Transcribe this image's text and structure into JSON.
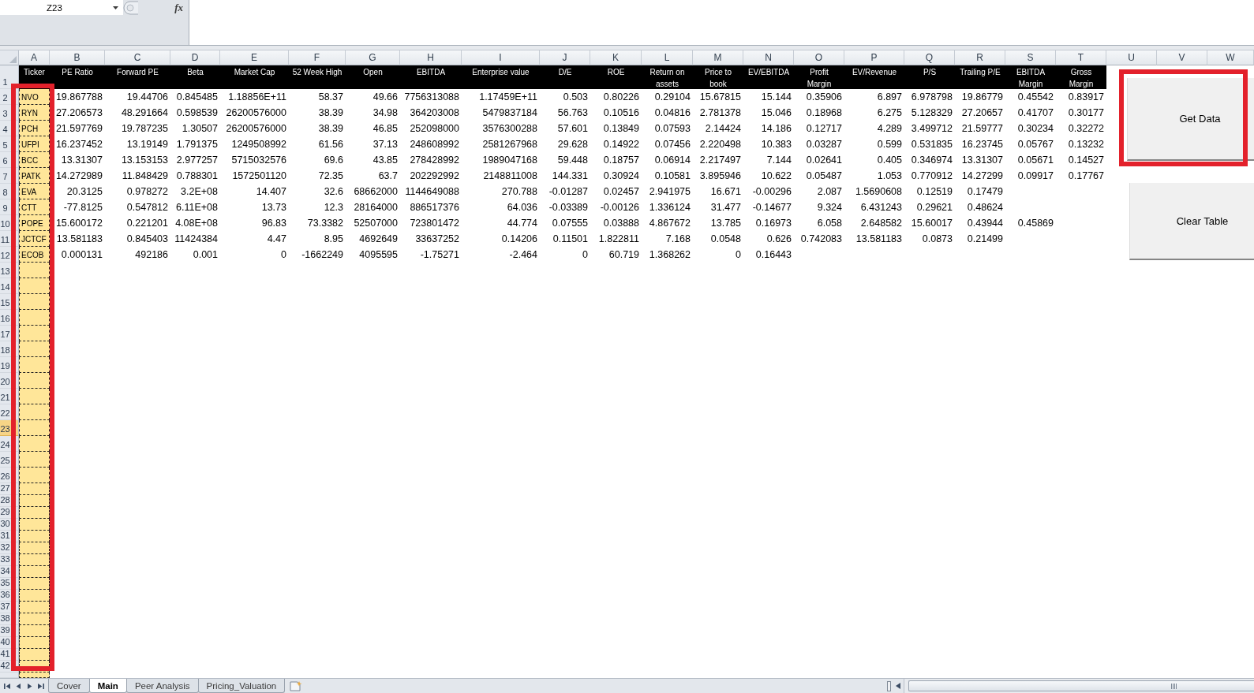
{
  "formula_bar": {
    "name_box": "Z23",
    "function_button": "fx"
  },
  "sheet": {
    "columns": [
      {
        "letter": "A",
        "highlighted": true
      },
      {
        "letter": "B",
        "highlighted": false
      },
      {
        "letter": "C",
        "highlighted": false
      },
      {
        "letter": "D",
        "highlighted": false
      },
      {
        "letter": "E",
        "highlighted": false
      },
      {
        "letter": "F",
        "highlighted": false
      },
      {
        "letter": "G",
        "highlighted": false
      },
      {
        "letter": "H",
        "highlighted": false
      },
      {
        "letter": "I",
        "highlighted": false
      },
      {
        "letter": "J",
        "highlighted": false
      },
      {
        "letter": "K",
        "highlighted": false
      },
      {
        "letter": "L",
        "highlighted": false
      },
      {
        "letter": "M",
        "highlighted": false
      },
      {
        "letter": "N",
        "highlighted": false
      },
      {
        "letter": "O",
        "highlighted": false
      },
      {
        "letter": "P",
        "highlighted": false
      },
      {
        "letter": "Q",
        "highlighted": false
      },
      {
        "letter": "R",
        "highlighted": false
      },
      {
        "letter": "S",
        "highlighted": false
      },
      {
        "letter": "T",
        "highlighted": false
      },
      {
        "letter": "U",
        "highlighted": false
      },
      {
        "letter": "V",
        "highlighted": false
      },
      {
        "letter": "W",
        "highlighted": false
      }
    ],
    "rows": [
      {
        "number": "1",
        "kind": "header",
        "selected": false,
        "cells": [
          "Ticker",
          "PE Ratio",
          "Forward PE",
          "Beta",
          "Market Cap",
          "52 Week High",
          "Open",
          "EBITDA",
          "Enterprise value",
          "D/E",
          "ROE",
          "Return on assets",
          "Price to book",
          "EV/EBITDA",
          "Profit Margin",
          "EV/Revenue",
          "P/S",
          "Trailing P/E",
          "EBITDA Margin",
          "Gross Margin"
        ]
      },
      {
        "number": "2",
        "kind": "data",
        "selected": false,
        "cells": [
          "NVO",
          "19.867788",
          "19.44706",
          "0.845485",
          "1.18856E+11",
          "58.37",
          "49.66",
          "7756313088",
          "1.17459E+11",
          "0.503",
          "0.80226",
          "0.29104",
          "15.67815",
          "15.144",
          "0.35906",
          "6.897",
          "6.978798",
          "19.86779",
          "0.45542",
          "0.83917"
        ]
      },
      {
        "number": "3",
        "kind": "data",
        "selected": false,
        "cells": [
          "RYN",
          "27.206573",
          "48.291664",
          "0.598539",
          "26200576000",
          "38.39",
          "34.98",
          "364203008",
          "5479837184",
          "56.763",
          "0.10516",
          "0.04816",
          "2.781378",
          "15.046",
          "0.18968",
          "6.275",
          "5.128329",
          "27.20657",
          "0.41707",
          "0.30177"
        ]
      },
      {
        "number": "4",
        "kind": "data",
        "selected": false,
        "cells": [
          "PCH",
          "21.597769",
          "19.787235",
          "1.30507",
          "26200576000",
          "38.39",
          "46.85",
          "252098000",
          "3576300288",
          "57.601",
          "0.13849",
          "0.07593",
          "2.14424",
          "14.186",
          "0.12717",
          "4.289",
          "3.499712",
          "21.59777",
          "0.30234",
          "0.32272"
        ]
      },
      {
        "number": "5",
        "kind": "data",
        "selected": false,
        "cells": [
          "UFPI",
          "16.237452",
          "13.19149",
          "1.791375",
          "1249508992",
          "61.56",
          "37.13",
          "248608992",
          "2581267968",
          "29.628",
          "0.14922",
          "0.07456",
          "2.220498",
          "10.383",
          "0.03287",
          "0.599",
          "0.531835",
          "16.23745",
          "0.05767",
          "0.13232"
        ]
      },
      {
        "number": "6",
        "kind": "data",
        "selected": false,
        "cells": [
          "BCC",
          "13.31307",
          "13.153153",
          "2.977257",
          "5715032576",
          "69.6",
          "43.85",
          "278428992",
          "1989047168",
          "59.448",
          "0.18757",
          "0.06914",
          "2.217497",
          "7.144",
          "0.02641",
          "0.405",
          "0.346974",
          "13.31307",
          "0.05671",
          "0.14527"
        ]
      },
      {
        "number": "7",
        "kind": "data",
        "selected": false,
        "cells": [
          "PATK",
          "14.272989",
          "11.848429",
          "0.788301",
          "1572501120",
          "72.35",
          "63.7",
          "202292992",
          "2148811008",
          "144.331",
          "0.30924",
          "0.10581",
          "3.895946",
          "10.622",
          "0.05487",
          "1.053",
          "0.770912",
          "14.27299",
          "0.09917",
          "0.17767"
        ]
      },
      {
        "number": "8",
        "kind": "data",
        "selected": false,
        "cells": [
          "EVA",
          "20.3125",
          "0.978272",
          "3.2E+08",
          "14.407",
          "32.6",
          "68662000",
          "1144649088",
          "270.788",
          "-0.01287",
          "0.02457",
          "2.941975",
          "16.671",
          "-0.00296",
          "2.087",
          "1.5690608",
          "0.12519",
          "0.17479"
        ]
      },
      {
        "number": "9",
        "kind": "data",
        "selected": false,
        "cells": [
          "CTT",
          "-77.8125",
          "0.547812",
          "6.11E+08",
          "13.73",
          "12.3",
          "28164000",
          "886517376",
          "64.036",
          "-0.03389",
          "-0.00126",
          "1.336124",
          "31.477",
          "-0.14677",
          "9.324",
          "6.431243",
          "0.29621",
          "0.48624"
        ]
      },
      {
        "number": "10",
        "kind": "data",
        "selected": false,
        "cells": [
          "POPE",
          "15.600172",
          "0.221201",
          "4.08E+08",
          "96.83",
          "73.3382",
          "52507000",
          "723801472",
          "44.774",
          "0.07555",
          "0.03888",
          "4.867672",
          "13.785",
          "0.16973",
          "6.058",
          "2.648582",
          "15.60017",
          "0.43944",
          "0.45869"
        ]
      },
      {
        "number": "11",
        "kind": "data",
        "selected": false,
        "cells": [
          "JCTCF",
          "13.581183",
          "0.845403",
          "11424384",
          "4.47",
          "8.95",
          "4692649",
          "33637252",
          "0.14206",
          "0.11501",
          "1.822811",
          "7.168",
          "0.0548",
          "0.626",
          "0.742083",
          "13.581183",
          "0.0873",
          "0.21499"
        ]
      },
      {
        "number": "12",
        "kind": "data",
        "selected": false,
        "cells": [
          "ECOB",
          "0.000131",
          "492186",
          "0.001",
          "0",
          "-1662249",
          "4095595",
          "-1.75271",
          "-2.464",
          "0",
          "60.719",
          "1.368262",
          "0",
          "0.16443"
        ]
      },
      {
        "number": "13",
        "kind": "data",
        "selected": false
      },
      {
        "number": "14",
        "kind": "data",
        "selected": false
      },
      {
        "number": "15",
        "kind": "data",
        "selected": false
      },
      {
        "number": "16",
        "kind": "data",
        "selected": false
      },
      {
        "number": "17",
        "kind": "data",
        "selected": false
      },
      {
        "number": "18",
        "kind": "data",
        "selected": false
      },
      {
        "number": "19",
        "kind": "data",
        "selected": false
      },
      {
        "number": "20",
        "kind": "data",
        "selected": false
      },
      {
        "number": "21",
        "kind": "data",
        "selected": false
      },
      {
        "number": "22",
        "kind": "data",
        "selected": false
      },
      {
        "number": "23",
        "kind": "data",
        "selected": true
      },
      {
        "number": "24",
        "kind": "data",
        "selected": false
      },
      {
        "number": "25",
        "kind": "data",
        "selected": false
      },
      {
        "number": "26",
        "kind": "data",
        "selected": false
      },
      {
        "number": "27",
        "kind": "data",
        "selected": false
      },
      {
        "number": "28",
        "kind": "data",
        "selected": false
      },
      {
        "number": "29",
        "kind": "data",
        "selected": false
      },
      {
        "number": "30",
        "kind": "data",
        "selected": false
      },
      {
        "number": "31",
        "kind": "data",
        "selected": false
      },
      {
        "number": "32",
        "kind": "data",
        "selected": false
      },
      {
        "number": "33",
        "kind": "data",
        "selected": false
      },
      {
        "number": "34",
        "kind": "data",
        "selected": false
      },
      {
        "number": "35",
        "kind": "data",
        "selected": false
      },
      {
        "number": "36",
        "kind": "data",
        "selected": false
      },
      {
        "number": "37",
        "kind": "data",
        "selected": false
      },
      {
        "number": "38",
        "kind": "data",
        "selected": false
      },
      {
        "number": "39",
        "kind": "data",
        "selected": false
      },
      {
        "number": "40",
        "kind": "data",
        "selected": false
      },
      {
        "number": "41",
        "kind": "data",
        "selected": false
      },
      {
        "number": "42",
        "kind": "data",
        "selected": false
      }
    ]
  },
  "buttons": [
    {
      "label": "Get Data",
      "highlighted": true
    },
    {
      "label": "Clear Table",
      "highlighted": false
    }
  ],
  "sheet_tabs": [
    {
      "label": "Cover",
      "selected": false
    },
    {
      "label": "Main",
      "selected": true
    },
    {
      "label": "Peer Analysis",
      "selected": false
    },
    {
      "label": "Pricing_Valuation",
      "selected": false
    }
  ]
}
